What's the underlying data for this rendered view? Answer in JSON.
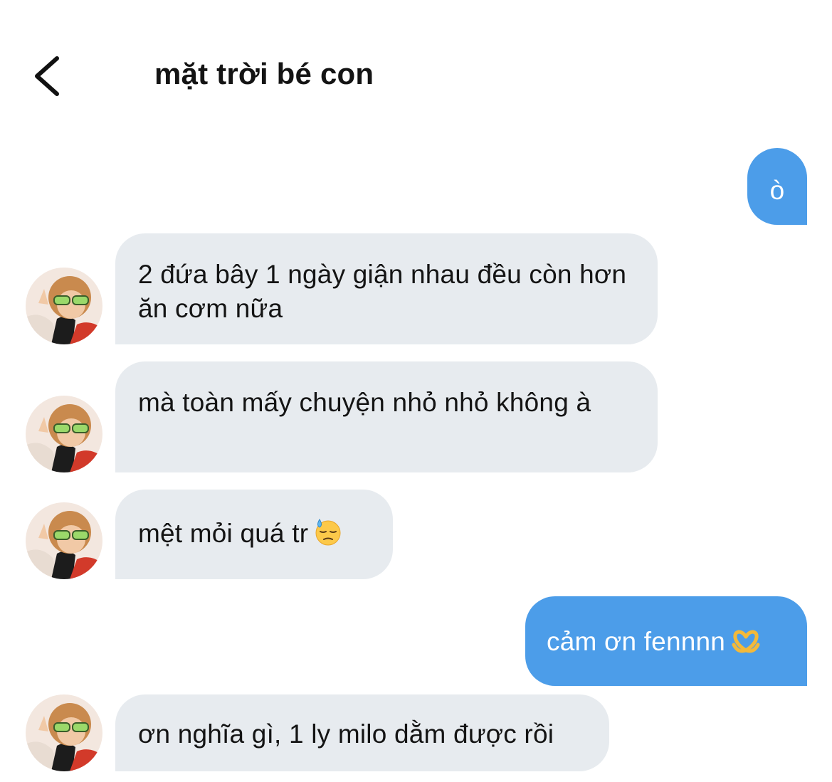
{
  "header": {
    "back_icon": "chevron-left-icon",
    "title": "mặt trời bé con"
  },
  "messages": [
    {
      "side": "outgoing",
      "text": "ò"
    },
    {
      "side": "incoming",
      "text": "2 đứa bây 1 ngày giận nhau đều còn hơn ăn cơm nữa"
    },
    {
      "side": "incoming",
      "text": "mà toàn mấy chuyện nhỏ nhỏ không à"
    },
    {
      "side": "incoming",
      "text": "mệt mỏi quá tr",
      "emoji": "downcast-face-with-sweat-icon"
    },
    {
      "side": "outgoing",
      "text": "cảm ơn fennnn",
      "emoji": "heart-hands-icon"
    },
    {
      "side": "incoming",
      "text": "ơn nghĩa gì, 1 ly milo dằm được rồi"
    }
  ],
  "colors": {
    "outgoing_bubble": "#4c9de9",
    "incoming_bubble": "#e7ebef",
    "text": "#141414"
  }
}
